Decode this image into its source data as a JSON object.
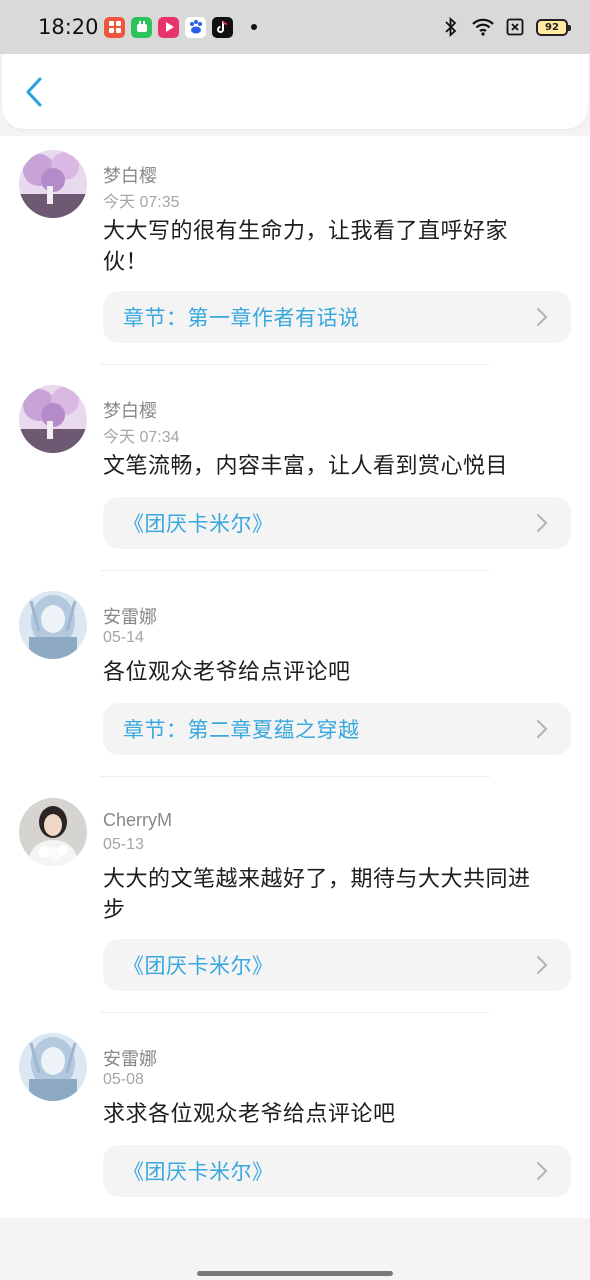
{
  "status_bar": {
    "time": "18:20",
    "battery": "92",
    "app_icons": [
      "app-red-icon",
      "app-green-icon",
      "app-video-icon",
      "baidu-icon",
      "tiktok-icon"
    ],
    "system_icons": [
      "bluetooth-icon",
      "wifi-icon",
      "sim-off-icon",
      "battery-icon"
    ]
  },
  "header": {
    "back_icon": "chevron-left-icon"
  },
  "accent_color": "#39a8de",
  "comments": [
    {
      "user": "梦白樱",
      "time": "今天 07:35",
      "text": "大大写的很有生命力，让我看了直呼好家伙！",
      "source": "章节：第一章作者有话说"
    },
    {
      "user": "梦白樱",
      "time": "今天 07:34",
      "text": "文笔流畅，内容丰富，让人看到赏心悦目",
      "source": "《团厌卡米尔》"
    },
    {
      "user": "安雷娜",
      "time": "05-14",
      "text": "各位观众老爷给点评论吧",
      "source": "章节：第二章夏蕴之穿越"
    },
    {
      "user": "CherryM",
      "time": "05-13",
      "text": "大大的文笔越来越好了，期待与大大共同进步",
      "source": "《团厌卡米尔》"
    },
    {
      "user": "安雷娜",
      "time": "05-08",
      "text": "求求各位观众老爷给点评论吧",
      "source": "《团厌卡米尔》"
    }
  ]
}
